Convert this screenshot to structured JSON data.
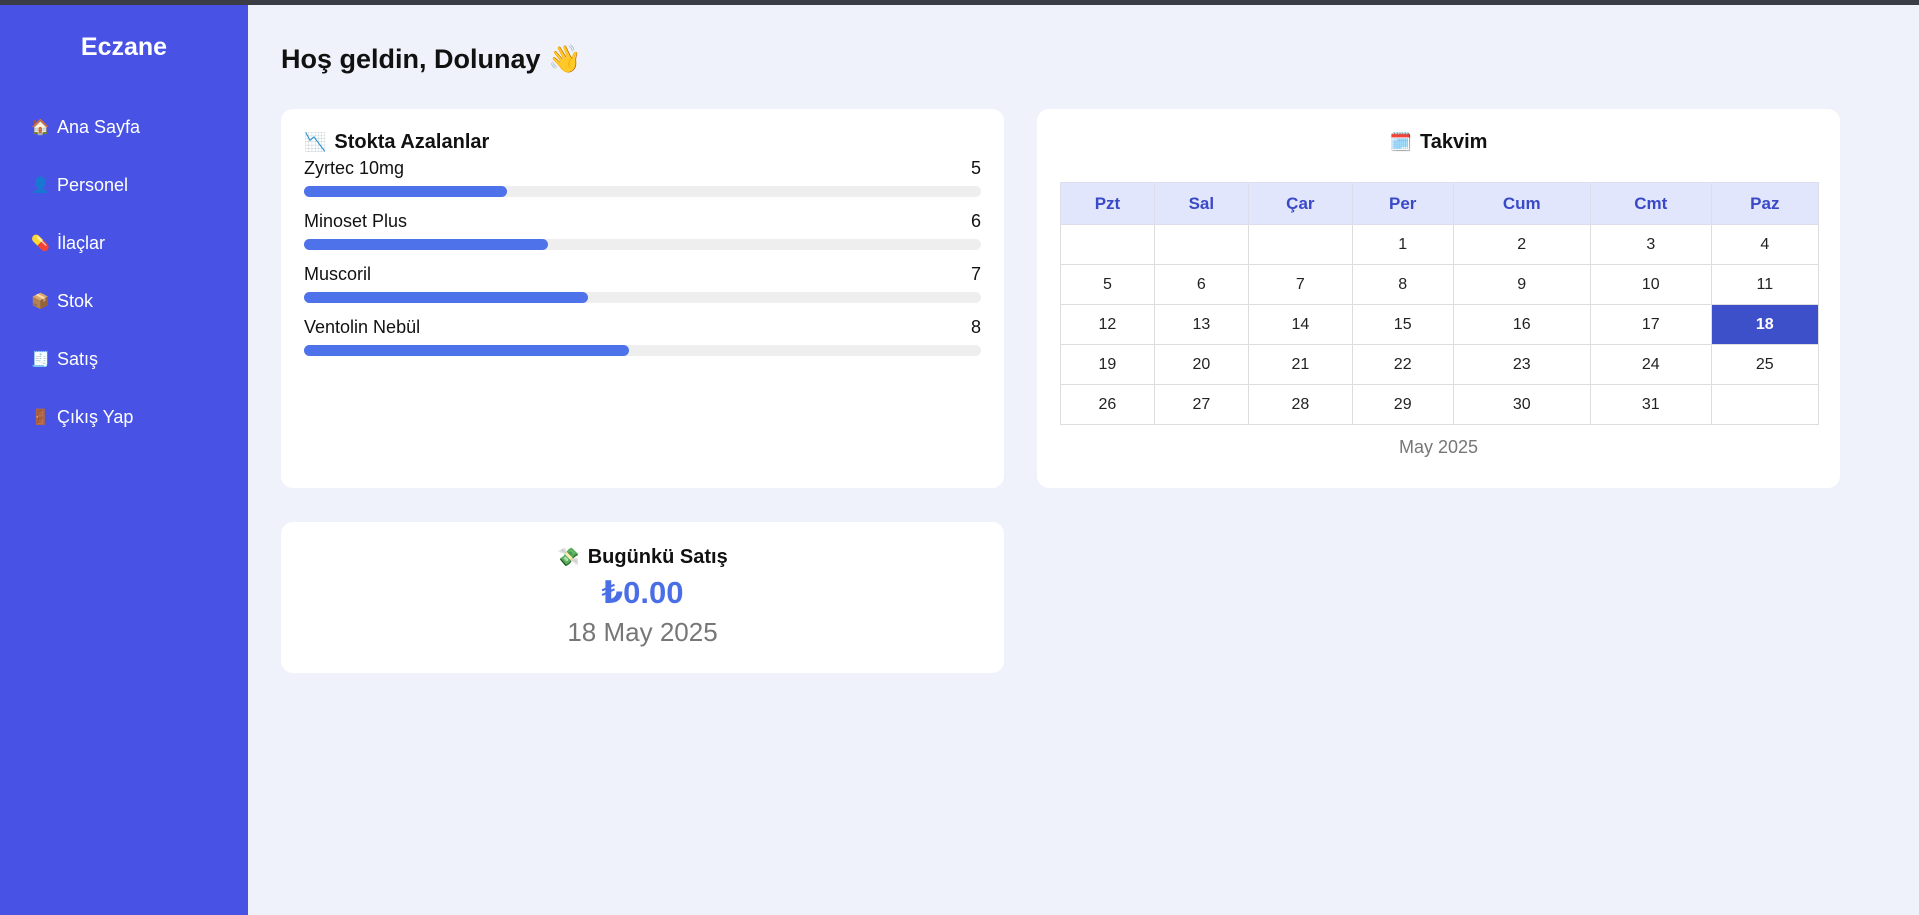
{
  "sidebar": {
    "brand": "Eczane",
    "items": [
      {
        "icon": "🏠",
        "label": "Ana Sayfa"
      },
      {
        "icon": "👤",
        "label": "Personel"
      },
      {
        "icon": "💊",
        "label": "İlaçlar"
      },
      {
        "icon": "📦",
        "label": "Stok"
      },
      {
        "icon": "🧾",
        "label": "Satış"
      },
      {
        "icon": "🚪",
        "label": "Çıkış Yap"
      }
    ]
  },
  "welcome": {
    "prefix": "Hoş geldin,",
    "name": "Dolunay",
    "emoji": "👋"
  },
  "stock": {
    "icon": "📉",
    "title": "Stokta Azalanlar",
    "items": [
      {
        "name": "Zyrtec 10mg",
        "qty": "5",
        "fill": 0.3
      },
      {
        "name": "Minoset Plus",
        "qty": "6",
        "fill": 0.36
      },
      {
        "name": "Muscoril",
        "qty": "7",
        "fill": 0.42
      },
      {
        "name": "Ventolin Nebül",
        "qty": "8",
        "fill": 0.48
      }
    ],
    "bar_color": "#4d72ea"
  },
  "calendar": {
    "icon": "🗓️",
    "title": "Takvim",
    "weekdays": [
      "Pzt",
      "Sal",
      "Çar",
      "Per",
      "Cum",
      "Cmt",
      "Paz"
    ],
    "weeks": [
      [
        "",
        "",
        "",
        "1",
        "2",
        "3",
        "4"
      ],
      [
        "5",
        "6",
        "7",
        "8",
        "9",
        "10",
        "11"
      ],
      [
        "12",
        "13",
        "14",
        "15",
        "16",
        "17",
        "18"
      ],
      [
        "19",
        "20",
        "21",
        "22",
        "23",
        "24",
        "25"
      ],
      [
        "26",
        "27",
        "28",
        "29",
        "30",
        "31",
        ""
      ]
    ],
    "today": "18",
    "caption": "May 2025"
  },
  "sales": {
    "icon": "💸",
    "title": "Bugünkü Satış",
    "amount": "₺0.00",
    "date": "18 May 2025"
  },
  "colors": {
    "sidebar": "#4853e5",
    "accent": "#4a6ee6",
    "today": "#3d4fc9"
  }
}
